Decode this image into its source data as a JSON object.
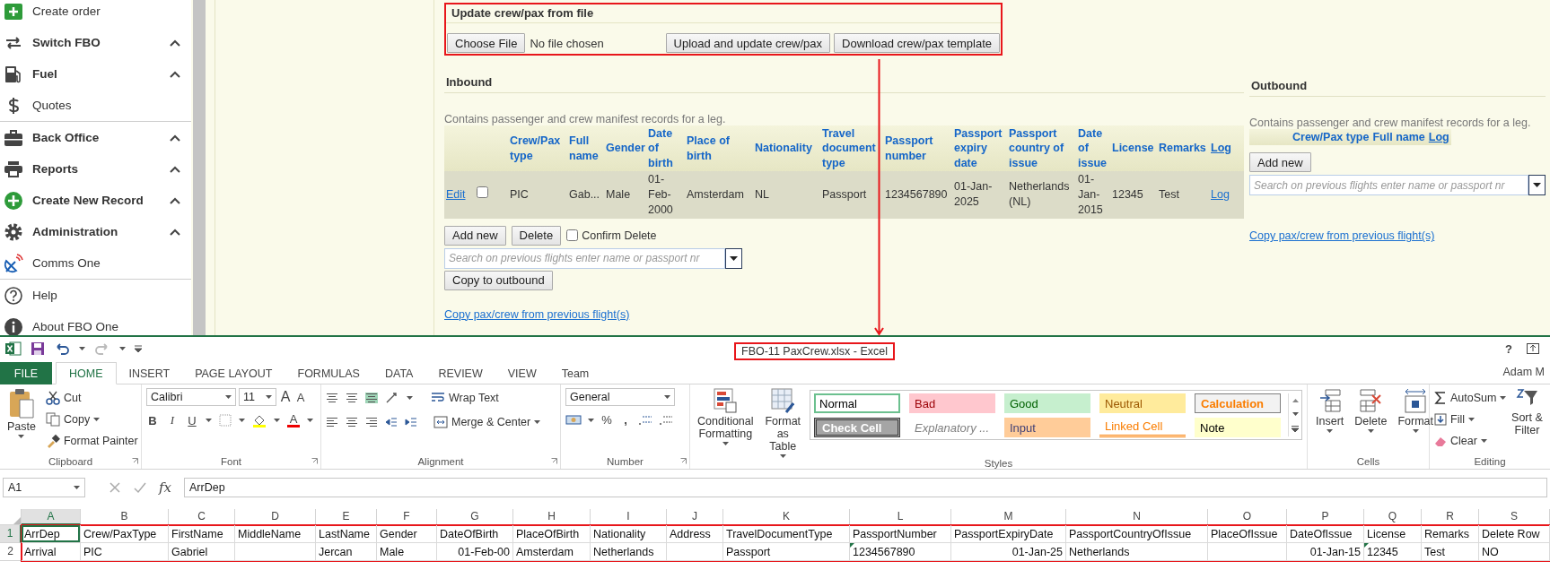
{
  "sidebar": {
    "groups": [
      [
        {
          "label": "Create order",
          "kind": "link"
        },
        {
          "label": "Switch FBO",
          "kind": "section"
        },
        {
          "label": "Fuel",
          "kind": "section"
        },
        {
          "label": "Quotes",
          "kind": "link"
        }
      ],
      [
        {
          "label": "Back Office",
          "kind": "section"
        },
        {
          "label": "Reports",
          "kind": "section"
        },
        {
          "label": "Create New Record",
          "kind": "section"
        },
        {
          "label": "Administration",
          "kind": "section"
        },
        {
          "label": "Comms One",
          "kind": "link"
        }
      ],
      [
        {
          "label": "Help",
          "kind": "link"
        },
        {
          "label": "About FBO One",
          "kind": "link"
        }
      ]
    ]
  },
  "update_panel": {
    "title": "Update crew/pax from file",
    "file_button": "Choose File",
    "file_status": "No file chosen",
    "buttons": [
      "Upload and update crew/pax",
      "Download crew/pax template"
    ]
  },
  "inbound": {
    "heading": "Inbound",
    "description": "Contains passenger and crew manifest records for a leg.",
    "columns": [
      {
        "label": "Crew/Pax type",
        "kind": "text"
      },
      {
        "label": "Full name",
        "kind": "text"
      },
      {
        "label": "Gender",
        "kind": "text"
      },
      {
        "label": "Date of birth",
        "kind": "text"
      },
      {
        "label": "Place of birth",
        "kind": "text"
      },
      {
        "label": "Nationality",
        "kind": "text"
      },
      {
        "label": "Travel document type",
        "kind": "text"
      },
      {
        "label": "Passport number",
        "kind": "text"
      },
      {
        "label": "Passport expiry date",
        "kind": "text"
      },
      {
        "label": "Passport country of issue",
        "kind": "text"
      },
      {
        "label": "Date of issue",
        "kind": "text"
      },
      {
        "label": "License",
        "kind": "text"
      },
      {
        "label": "Remarks",
        "kind": "text"
      },
      {
        "label": "Log",
        "kind": "link"
      }
    ],
    "rows": [
      {
        "edit": "Edit",
        "checked": false,
        "cells": [
          "PIC",
          "Gab...",
          "Male",
          "01-Feb-2000",
          "Amsterdam",
          "NL",
          "Passport",
          "1234567890",
          "01-Jan-2025",
          "Netherlands (NL)",
          "01-Jan-2015",
          "12345",
          "Test",
          "Log"
        ]
      }
    ],
    "add_button": "Add new",
    "delete_button": "Delete",
    "confirm": {
      "label": "Confirm Delete",
      "checked": false
    },
    "search": {
      "placeholder": "Search on previous flights enter name or passport nr"
    },
    "copy_button": "Copy to outbound",
    "link": "Copy pax/crew from previous flight(s)"
  },
  "outbound": {
    "heading": "Outbound",
    "description": "Contains passenger and crew manifest records for a leg.",
    "columns": [
      {
        "label": "Crew/Pax type",
        "kind": "text"
      },
      {
        "label": "Full name",
        "kind": "text"
      },
      {
        "label": "Log",
        "kind": "link"
      }
    ],
    "add_button": "Add new",
    "search": {
      "placeholder": "Search on previous flights enter name or passport nr"
    },
    "link": "Copy pax/crew from previous flight(s)"
  },
  "excel": {
    "title": "FBO-11 PaxCrew.xlsx - Excel",
    "help": "?",
    "user": "Adam M",
    "tabs": [
      {
        "label": "FILE",
        "kind": "file",
        "selected": false
      },
      {
        "label": "HOME",
        "kind": "tab",
        "selected": true
      },
      {
        "label": "INSERT",
        "kind": "tab",
        "selected": false
      },
      {
        "label": "PAGE LAYOUT",
        "kind": "tab",
        "selected": false
      },
      {
        "label": "FORMULAS",
        "kind": "tab",
        "selected": false
      },
      {
        "label": "DATA",
        "kind": "tab",
        "selected": false
      },
      {
        "label": "REVIEW",
        "kind": "tab",
        "selected": false
      },
      {
        "label": "VIEW",
        "kind": "tab",
        "selected": false
      },
      {
        "label": "Team",
        "kind": "tab",
        "selected": false
      }
    ],
    "ribbon": {
      "clipboard": {
        "label": "Clipboard",
        "paste": "Paste",
        "cut": "Cut",
        "copy": "Copy",
        "format_painter": "Format Painter"
      },
      "font": {
        "label": "Font",
        "name": "Calibri",
        "size": "11",
        "grow": "A",
        "shrink": "A",
        "bold": "B",
        "italic": "I",
        "underline": "U",
        "color_button": "A"
      },
      "alignment": {
        "label": "Alignment",
        "wrap": "Wrap Text",
        "merge": "Merge & Center"
      },
      "number": {
        "label": "Number",
        "format": "General",
        "percent": "%",
        "comma": ","
      },
      "styles": {
        "label": "Styles",
        "conditional": "Conditional Formatting",
        "format_table": "Format as Table",
        "cells": [
          {
            "label": "Normal",
            "kind": "normal",
            "selected": true,
            "color": "#ffffff"
          },
          {
            "label": "Bad",
            "kind": "bad",
            "selected": false,
            "color": "#ffc7ce"
          },
          {
            "label": "Good",
            "kind": "good",
            "selected": false,
            "color": "#c6efce"
          },
          {
            "label": "Neutral",
            "kind": "neutral",
            "selected": false,
            "color": "#ffeb9c"
          },
          {
            "label": "Calculation",
            "kind": "calculation",
            "selected": false,
            "color": "#f2f2f2"
          },
          {
            "label": "Check Cell",
            "kind": "check",
            "selected": false,
            "color": "#a5a5a5"
          },
          {
            "label": "Explanatory ...",
            "kind": "explanatory",
            "selected": false,
            "color": "#ffffff"
          },
          {
            "label": "Input",
            "kind": "input",
            "selected": false,
            "color": "#ffcc99"
          },
          {
            "label": "Linked Cell",
            "kind": "linked",
            "selected": false,
            "color": "#ffffff"
          },
          {
            "label": "Note",
            "kind": "note",
            "selected": false,
            "color": "#ffffcc"
          }
        ]
      },
      "cells": {
        "label": "Cells",
        "buttons": [
          "Insert",
          "Delete",
          "Format"
        ]
      },
      "editing": {
        "label": "Editing",
        "autosum": "AutoSum",
        "fill": "Fill",
        "clear": "Clear",
        "sort": "Sort & Filter"
      }
    },
    "formula_bar": {
      "name_box": "A1",
      "fx": "fx",
      "value": "ArrDep"
    },
    "grid": {
      "columns": [
        {
          "letter": "A",
          "selected": true
        },
        {
          "letter": "B",
          "selected": false
        },
        {
          "letter": "C",
          "selected": false
        },
        {
          "letter": "D",
          "selected": false
        },
        {
          "letter": "E",
          "selected": false
        },
        {
          "letter": "F",
          "selected": false
        },
        {
          "letter": "G",
          "selected": false
        },
        {
          "letter": "H",
          "selected": false
        },
        {
          "letter": "I",
          "selected": false
        },
        {
          "letter": "J",
          "selected": false
        },
        {
          "letter": "K",
          "selected": false
        },
        {
          "letter": "L",
          "selected": false
        },
        {
          "letter": "M",
          "selected": false
        },
        {
          "letter": "N",
          "selected": false
        },
        {
          "letter": "O",
          "selected": false
        },
        {
          "letter": "P",
          "selected": false
        },
        {
          "letter": "Q",
          "selected": false
        },
        {
          "letter": "R",
          "selected": false
        },
        {
          "letter": "S",
          "selected": false
        }
      ],
      "rows": [
        {
          "number": "1",
          "selected": true,
          "cells": [
            "ArrDep",
            "Crew/PaxType",
            "FirstName",
            "MiddleName",
            "LastName",
            "Gender",
            "DateOfBirth",
            "PlaceOfBirth",
            "Nationality",
            "Address",
            "TravelDocumentType",
            "PassportNumber",
            "PassportExpiryDate",
            "PassportCountryOfIssue",
            "PlaceOfIssue",
            "DateOfIssue",
            "License",
            "Remarks",
            "Delete Row"
          ]
        },
        {
          "number": "2",
          "selected": false,
          "cells": [
            "Arrival",
            "PIC",
            "Gabriel",
            null,
            "Jercan",
            "Male",
            {
              "text": "01-Feb-00",
              "kind": "number"
            },
            "Amsterdam",
            "Netherlands",
            null,
            "Passport",
            {
              "text": "1234567890",
              "flag": true
            },
            {
              "text": "01-Jan-25",
              "kind": "number"
            },
            "Netherlands",
            null,
            {
              "text": "01-Jan-15",
              "kind": "number"
            },
            {
              "text": "12345",
              "flag": true
            },
            "Test",
            "NO"
          ]
        }
      ]
    }
  }
}
